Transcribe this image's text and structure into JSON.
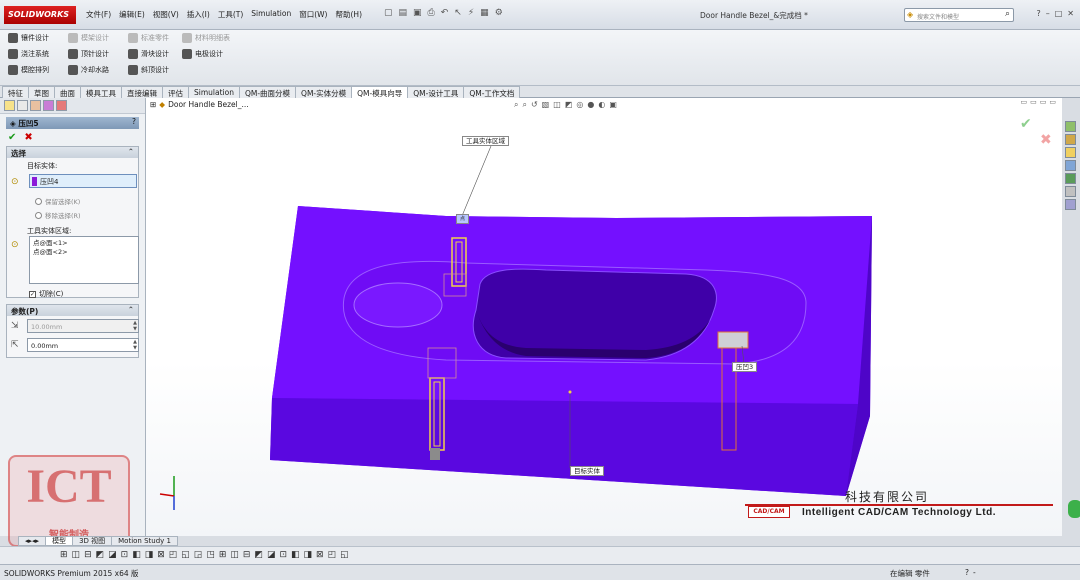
{
  "app": {
    "logo_text": "SOLIDWORKS",
    "document_title": "Door Handle Bezel_&完成档 *",
    "menu": [
      "文件(F)",
      "编辑(E)",
      "视图(V)",
      "插入(I)",
      "工具(T)",
      "Simulation",
      "窗口(W)",
      "帮助(H)"
    ],
    "search_placeholder": "搜索文件和模型",
    "window_controls": [
      "?",
      "–",
      "□",
      "✕"
    ]
  },
  "command_manager": {
    "row1": [
      "镶件设计",
      "模架设计",
      "标准零件",
      "材料明细表"
    ],
    "row2": [
      "浇注系统",
      "顶针设计",
      "滑块设计",
      "电极设计"
    ],
    "row3": [
      "模腔排列",
      "冷却水路",
      "斜顶设计"
    ]
  },
  "tabs": [
    "特征",
    "草图",
    "曲面",
    "模具工具",
    "直接编辑",
    "评估",
    "Simulation",
    "QM-曲面分模",
    "QM-实体分模",
    "QM-模具向导",
    "QM-设计工具",
    "QM-工作文档"
  ],
  "active_tab": "QM-模具向导",
  "property_manager": {
    "title": "压凹5",
    "help": "?",
    "selection": {
      "header": "选择",
      "target_label": "目标实体:",
      "target_value": "压凹4",
      "keep_label": "保留选择(K)",
      "remove_label": "移除选择(R)",
      "tool_region_label": "工具实体区域:",
      "tool_regions": [
        "点@面<1>",
        "点@面<2>"
      ],
      "cut_label": "切除(C)",
      "cut_checked": "✓"
    },
    "parameters": {
      "header": "参数(P)",
      "thickness": "10.00mm",
      "clearance": "0.00mm"
    }
  },
  "viewport": {
    "feature_tree_label": "Door Handle Bezel_...",
    "callouts": {
      "tool_region": "工具实体区域",
      "target_body": "目标实体",
      "feature": "压凹3",
      "small_marker": "点"
    },
    "body_color": "#6a0bff",
    "accent_yellow": "#f2d14a"
  },
  "bottom_tabs": [
    "模型",
    "3D 视图",
    "Motion Study 1"
  ],
  "active_bottom_tab": "模型",
  "status": {
    "left": "SOLIDWORKS Premium 2015 x64 版",
    "mid": "在编辑 零件",
    "right": [
      "?",
      "-"
    ]
  },
  "watermark": {
    "ict": "ICT",
    "ict_sub": "智能制造",
    "company_cn": "科技有限公司",
    "cadcam_logo": "CAD/CAM",
    "company_en": "Intelligent CAD/CAM Technology Ltd."
  }
}
